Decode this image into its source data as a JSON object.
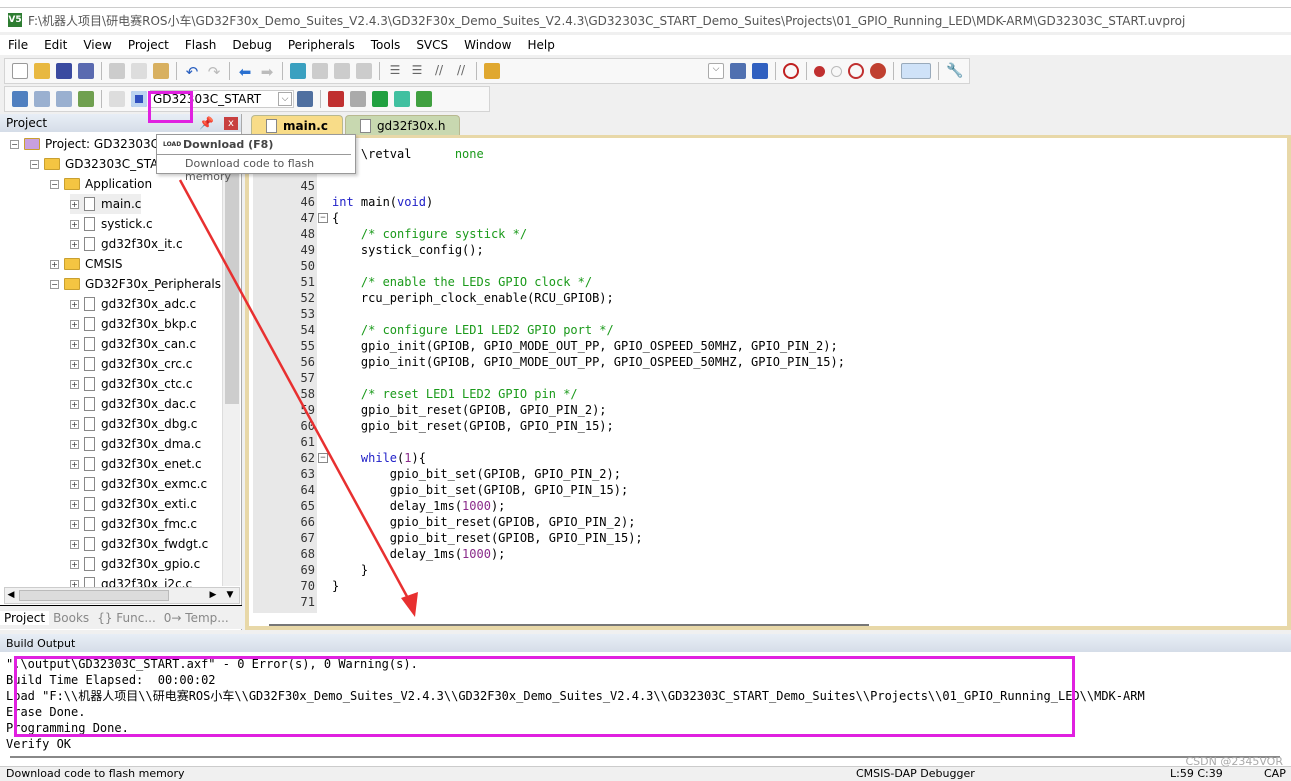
{
  "window": {
    "title": "F:\\机器人项目\\研电赛ROS小车\\GD32F30x_Demo_Suites_V2.4.3\\GD32F30x_Demo_Suites_V2.4.3\\GD32303C_START_Demo_Suites\\Projects\\01_GPIO_Running_LED\\MDK-ARM\\GD32303C_START.uvproj",
    "app_icon": "V5"
  },
  "menu": [
    "File",
    "Edit",
    "View",
    "Project",
    "Flash",
    "Debug",
    "Peripherals",
    "Tools",
    "SVCS",
    "Window",
    "Help"
  ],
  "toolbar2": {
    "target": "GD32303C_START"
  },
  "tooltip": {
    "title": "Download (F8)",
    "description": "Download code to flash memory",
    "icon_label": "LOAD"
  },
  "project_panel": {
    "title": "Project",
    "tree": [
      {
        "label": "Project: GD32303C_START",
        "level": 0,
        "kind": "project",
        "expanded": true
      },
      {
        "label": "GD32303C_START",
        "level": 1,
        "kind": "target",
        "expanded": true
      },
      {
        "label": "Application",
        "level": 2,
        "kind": "folder",
        "expanded": true
      },
      {
        "label": "main.c",
        "level": 3,
        "kind": "file",
        "selected": true
      },
      {
        "label": "systick.c",
        "level": 3,
        "kind": "file"
      },
      {
        "label": "gd32f30x_it.c",
        "level": 3,
        "kind": "file"
      },
      {
        "label": "CMSIS",
        "level": 2,
        "kind": "folder",
        "expanded": false
      },
      {
        "label": "GD32F30x_Peripherals",
        "level": 2,
        "kind": "folder",
        "expanded": true
      },
      {
        "label": "gd32f30x_adc.c",
        "level": 3,
        "kind": "file"
      },
      {
        "label": "gd32f30x_bkp.c",
        "level": 3,
        "kind": "file"
      },
      {
        "label": "gd32f30x_can.c",
        "level": 3,
        "kind": "file"
      },
      {
        "label": "gd32f30x_crc.c",
        "level": 3,
        "kind": "file"
      },
      {
        "label": "gd32f30x_ctc.c",
        "level": 3,
        "kind": "file"
      },
      {
        "label": "gd32f30x_dac.c",
        "level": 3,
        "kind": "file"
      },
      {
        "label": "gd32f30x_dbg.c",
        "level": 3,
        "kind": "file"
      },
      {
        "label": "gd32f30x_dma.c",
        "level": 3,
        "kind": "file"
      },
      {
        "label": "gd32f30x_enet.c",
        "level": 3,
        "kind": "file"
      },
      {
        "label": "gd32f30x_exmc.c",
        "level": 3,
        "kind": "file"
      },
      {
        "label": "gd32f30x_exti.c",
        "level": 3,
        "kind": "file"
      },
      {
        "label": "gd32f30x_fmc.c",
        "level": 3,
        "kind": "file"
      },
      {
        "label": "gd32f30x_fwdgt.c",
        "level": 3,
        "kind": "file"
      },
      {
        "label": "gd32f30x_gpio.c",
        "level": 3,
        "kind": "file"
      },
      {
        "label": "gd32f30x_i2c.c",
        "level": 3,
        "kind": "file"
      }
    ],
    "tabs": [
      "Project",
      "Books",
      "{} Func...",
      "0→ Temp..."
    ]
  },
  "editor": {
    "tabs": [
      {
        "label": "main.c",
        "active": true
      },
      {
        "label": "gd32f30x.h",
        "active": false
      }
    ],
    "lines": [
      {
        "n": "",
        "tokens": [
          [
            "    \\retval      ",
            "tx"
          ],
          [
            "none",
            "gr"
          ]
        ]
      },
      {
        "n": "",
        "tokens": []
      },
      {
        "n": "45",
        "tokens": []
      },
      {
        "n": "46",
        "tokens": [
          [
            "int",
            "kw"
          ],
          [
            " main(",
            "tx"
          ],
          [
            "void",
            "kw"
          ],
          [
            ")",
            "tx"
          ]
        ]
      },
      {
        "n": "47",
        "tokens": [
          [
            "{",
            "tx"
          ]
        ]
      },
      {
        "n": "48",
        "tokens": [
          [
            "    /* configure systick */",
            "cm"
          ]
        ]
      },
      {
        "n": "49",
        "tokens": [
          [
            "    systick_config();",
            "tx"
          ]
        ]
      },
      {
        "n": "50",
        "tokens": []
      },
      {
        "n": "51",
        "tokens": [
          [
            "    /* enable the LEDs GPIO clock */",
            "cm"
          ]
        ]
      },
      {
        "n": "52",
        "tokens": [
          [
            "    rcu_periph_clock_enable(RCU_GPIOB);",
            "tx"
          ]
        ]
      },
      {
        "n": "53",
        "tokens": []
      },
      {
        "n": "54",
        "tokens": [
          [
            "    /* configure LED1 LED2 GPIO port */",
            "cm"
          ]
        ]
      },
      {
        "n": "55",
        "tokens": [
          [
            "    gpio_init(GPIOB, GPIO_MODE_OUT_PP, GPIO_OSPEED_50MHZ, GPIO_PIN_2);",
            "tx"
          ]
        ]
      },
      {
        "n": "56",
        "tokens": [
          [
            "    gpio_init(GPIOB, GPIO_MODE_OUT_PP, GPIO_OSPEED_50MHZ, GPIO_PIN_15);",
            "tx"
          ]
        ]
      },
      {
        "n": "57",
        "tokens": []
      },
      {
        "n": "58",
        "tokens": [
          [
            "    /* reset LED1 LED2 GPIO pin */",
            "cm"
          ]
        ]
      },
      {
        "n": "59",
        "tokens": [
          [
            "    gpio_bit_reset(GPIOB, GPIO_PIN_2);",
            "tx"
          ]
        ]
      },
      {
        "n": "60",
        "tokens": [
          [
            "    gpio_bit_reset(GPIOB, GPIO_PIN_15);",
            "tx"
          ]
        ]
      },
      {
        "n": "61",
        "tokens": []
      },
      {
        "n": "62",
        "tokens": [
          [
            "    ",
            "tx"
          ],
          [
            "while",
            "kw"
          ],
          [
            "(",
            "tx"
          ],
          [
            "1",
            "num"
          ],
          [
            "){",
            "tx"
          ]
        ]
      },
      {
        "n": "63",
        "tokens": [
          [
            "        gpio_bit_set(GPIOB, GPIO_PIN_2);",
            "tx"
          ]
        ]
      },
      {
        "n": "64",
        "tokens": [
          [
            "        gpio_bit_set(GPIOB, GPIO_PIN_15);",
            "tx"
          ]
        ]
      },
      {
        "n": "65",
        "tokens": [
          [
            "        delay_1ms(",
            "tx"
          ],
          [
            "1000",
            "num"
          ],
          [
            ");",
            "tx"
          ]
        ]
      },
      {
        "n": "66",
        "tokens": [
          [
            "        gpio_bit_reset(GPIOB, GPIO_PIN_2);",
            "tx"
          ]
        ]
      },
      {
        "n": "67",
        "tokens": [
          [
            "        gpio_bit_reset(GPIOB, GPIO_PIN_15);",
            "tx"
          ]
        ]
      },
      {
        "n": "68",
        "tokens": [
          [
            "        delay_1ms(",
            "tx"
          ],
          [
            "1000",
            "num"
          ],
          [
            ");",
            "tx"
          ]
        ]
      },
      {
        "n": "69",
        "tokens": [
          [
            "    }",
            "tx"
          ]
        ]
      },
      {
        "n": "70",
        "tokens": [
          [
            "}",
            "tx"
          ]
        ]
      },
      {
        "n": "71",
        "tokens": []
      }
    ]
  },
  "build_output": {
    "title": "Build Output",
    "lines": [
      "\".\\output\\GD32303C_START.axf\" - 0 Error(s), 0 Warning(s).",
      "Build Time Elapsed:  00:00:02",
      "Load \"F:\\\\机器人项目\\\\研电赛ROS小车\\\\GD32F30x_Demo_Suites_V2.4.3\\\\GD32F30x_Demo_Suites_V2.4.3\\\\GD32303C_START_Demo_Suites\\\\Projects\\\\01_GPIO_Running_LED\\\\MDK-ARM",
      "Erase Done.",
      "Programming Done.",
      "Verify OK"
    ]
  },
  "status": {
    "hint": "Download code to flash memory",
    "debugger": "CMSIS-DAP Debugger",
    "position": "L:59 C:39",
    "caps": "CAP"
  },
  "watermark": "CSDN @2345VOR",
  "colors": {
    "highlight": "#e020e0",
    "arrow": "#e83030",
    "active_tab": "#f8dc88"
  }
}
